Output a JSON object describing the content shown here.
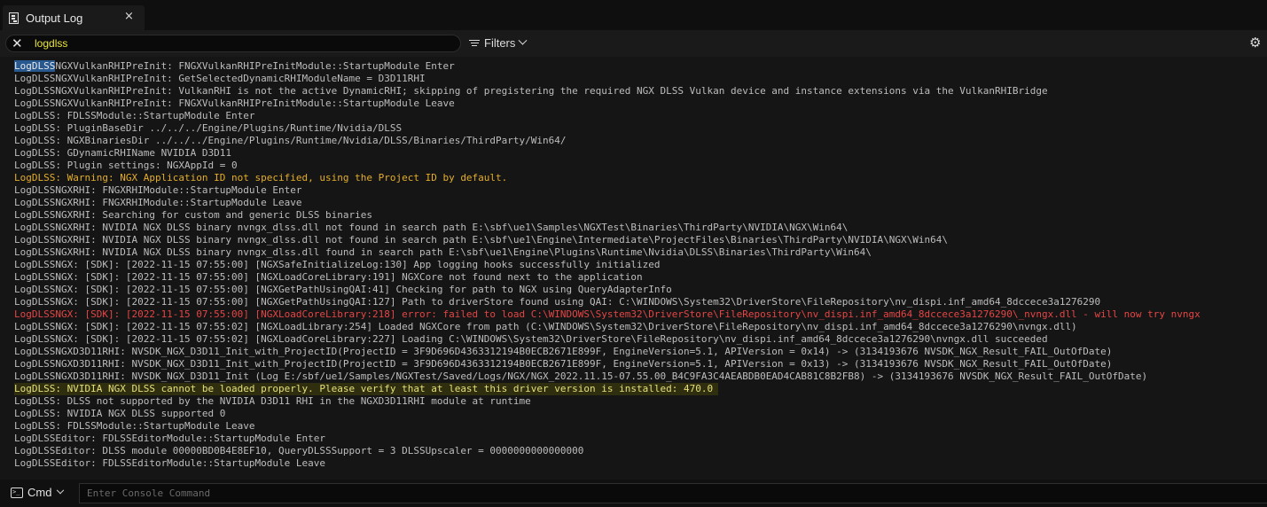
{
  "tab": {
    "title": "Output Log",
    "icon": "output-log-icon",
    "close_glyph": "×"
  },
  "toolbar": {
    "search_value": "logdlss",
    "filters_label": "Filters",
    "settings_glyph": "⚙"
  },
  "log": {
    "selection_text": "LogDLSS",
    "lines": [
      {
        "text": "NGXVulkanRHIPreInit: FNGXVulkanRHIPreInitModule::StartupModule Enter",
        "kind": "normal"
      },
      {
        "text": "LogDLSSNGXVulkanRHIPreInit: GetSelectedDynamicRHIModuleName = D3D11RHI",
        "kind": "normal"
      },
      {
        "text": "LogDLSSNGXVulkanRHIPreInit: VulkanRHI is not the active DynamicRHI; skipping of pregistering the required NGX DLSS Vulkan device and instance extensions via the VulkanRHIBridge",
        "kind": "normal"
      },
      {
        "text": "LogDLSSNGXVulkanRHIPreInit: FNGXVulkanRHIPreInitModule::StartupModule Leave",
        "kind": "normal"
      },
      {
        "text": "LogDLSS: FDLSSModule::StartupModule Enter",
        "kind": "normal"
      },
      {
        "text": "LogDLSS: PluginBaseDir ../../../Engine/Plugins/Runtime/Nvidia/DLSS",
        "kind": "normal"
      },
      {
        "text": "LogDLSS: NGXBinariesDir ../../../Engine/Plugins/Runtime/Nvidia/DLSS/Binaries/ThirdParty/Win64/",
        "kind": "normal"
      },
      {
        "text": "LogDLSS: GDynamicRHIName NVIDIA D3D11",
        "kind": "normal"
      },
      {
        "text": "LogDLSS: Plugin settings: NGXAppId = 0",
        "kind": "normal"
      },
      {
        "text": "LogDLSS: Warning: NGX Application ID not specified, using the Project ID by default.",
        "kind": "warn"
      },
      {
        "text": "LogDLSSNGXRHI: FNGXRHIModule::StartupModule Enter",
        "kind": "normal"
      },
      {
        "text": "LogDLSSNGXRHI: FNGXRHIModule::StartupModule Leave",
        "kind": "normal"
      },
      {
        "text": "LogDLSSNGXRHI: Searching for custom and generic DLSS binaries",
        "kind": "normal"
      },
      {
        "text": "LogDLSSNGXRHI: NVIDIA NGX DLSS binary nvngx_dlss.dll not found in search path E:\\sbf\\ue1\\Samples\\NGXTest\\Binaries\\ThirdParty\\NVIDIA\\NGX\\Win64\\",
        "kind": "normal"
      },
      {
        "text": "LogDLSSNGXRHI: NVIDIA NGX DLSS binary nvngx_dlss.dll not found in search path E:\\sbf\\ue1\\Engine\\Intermediate\\ProjectFiles\\Binaries\\ThirdParty\\NVIDIA\\NGX\\Win64\\",
        "kind": "normal"
      },
      {
        "text": "LogDLSSNGXRHI: NVIDIA NGX DLSS binary nvngx_dlss.dll found in search path E:\\sbf\\ue1\\Engine\\Plugins\\Runtime\\Nvidia\\DLSS\\Binaries\\ThirdParty\\Win64\\",
        "kind": "normal"
      },
      {
        "text": "LogDLSSNGX: [SDK]: [2022-11-15 07:55:00] [NGXSafeInitializeLog:130] App logging hooks successfully initialized",
        "kind": "normal"
      },
      {
        "text": "LogDLSSNGX: [SDK]: [2022-11-15 07:55:00] [NGXLoadCoreLibrary:191] NGXCore not found next to the application",
        "kind": "normal"
      },
      {
        "text": "LogDLSSNGX: [SDK]: [2022-11-15 07:55:00] [NGXGetPathUsingQAI:41] Checking for path to NGX using QueryAdapterInfo",
        "kind": "normal"
      },
      {
        "text": "LogDLSSNGX: [SDK]: [2022-11-15 07:55:00] [NGXGetPathUsingQAI:127] Path to driverStore found using QAI: C:\\WINDOWS\\System32\\DriverStore\\FileRepository\\nv_dispi.inf_amd64_8dccece3a1276290",
        "kind": "normal"
      },
      {
        "text": "LogDLSSNGX: [SDK]: [2022-11-15 07:55:00] [NGXLoadCoreLibrary:218] error: failed to load C:\\WINDOWS\\System32\\DriverStore\\FileRepository\\nv_dispi.inf_amd64_8dccece3a1276290\\_nvngx.dll - will now try nvngx",
        "kind": "err"
      },
      {
        "text": "LogDLSSNGX: [SDK]: [2022-11-15 07:55:02] [NGXLoadLibrary:254] Loaded NGXCore from path (C:\\WINDOWS\\System32\\DriverStore\\FileRepository\\nv_dispi.inf_amd64_8dccece3a1276290\\nvngx.dll)",
        "kind": "normal"
      },
      {
        "text": "LogDLSSNGX: [SDK]: [2022-11-15 07:55:02] [NGXLoadCoreLibrary:227] Loading C:\\WINDOWS\\System32\\DriverStore\\FileRepository\\nv_dispi.inf_amd64_8dccece3a1276290\\nvngx.dll succeeded",
        "kind": "normal"
      },
      {
        "text": "LogDLSSNGXD3D11RHI: NVSDK_NGX_D3D11_Init_with_ProjectID(ProjectID = 3F9D696D4363312194B0ECB2671E899F, EngineVersion=5.1, APIVersion = 0x14) -> (3134193676 NVSDK_NGX_Result_FAIL_OutOfDate)",
        "kind": "normal"
      },
      {
        "text": "LogDLSSNGXD3D11RHI: NVSDK_NGX_D3D11_Init_with_ProjectID(ProjectID = 3F9D696D4363312194B0ECB2671E899F, EngineVersion=5.1, APIVersion = 0x13) -> (3134193676 NVSDK_NGX_Result_FAIL_OutOfDate)",
        "kind": "normal"
      },
      {
        "text": "LogDLSSNGXD3D11RHI: NVSDK_NGX_D3D11_Init (Log E:/sbf/ue1/Samples/NGXTest/Saved/Logs/NGX/NGX_2022.11.15-07.55.00_B4C9FA3C4AEABDB0EAD4CAB81C8B2FB8) -> (3134193676 NVSDK_NGX_Result_FAIL_OutOfDate)",
        "kind": "normal"
      },
      {
        "text": "LogDLSS: NVIDIA NGX DLSS cannot be loaded properly. Please verify that at least this driver version is installed: 470.0",
        "kind": "hl"
      },
      {
        "text": "LogDLSS: DLSS not supported by the NVIDIA D3D11 RHI in the NGXD3D11RHI module at runtime",
        "kind": "normal"
      },
      {
        "text": "LogDLSS: NVIDIA NGX DLSS supported 0",
        "kind": "normal"
      },
      {
        "text": "LogDLSS: FDLSSModule::StartupModule Leave",
        "kind": "normal"
      },
      {
        "text": "LogDLSSEditor: FDLSSEditorModule::StartupModule Enter",
        "kind": "normal"
      },
      {
        "text": "LogDLSSEditor: DLSS module 00000BD0B4E8EF10, QueryDLSSSupport = 3 DLSSUpscaler = 0000000000000000",
        "kind": "normal"
      },
      {
        "text": "LogDLSSEditor: FDLSSEditorModule::StartupModule Leave",
        "kind": "normal"
      }
    ]
  },
  "console": {
    "cmd_label": "Cmd",
    "cmd_icon_glyph": ">_",
    "placeholder": "Enter Console Command",
    "value": ""
  },
  "colors": {
    "background": "#151515",
    "search_text": "#e9e53c",
    "warning": "#e5ae2a",
    "error": "#e54545",
    "highlight": "#e6e07a",
    "selection": "#27588f"
  }
}
